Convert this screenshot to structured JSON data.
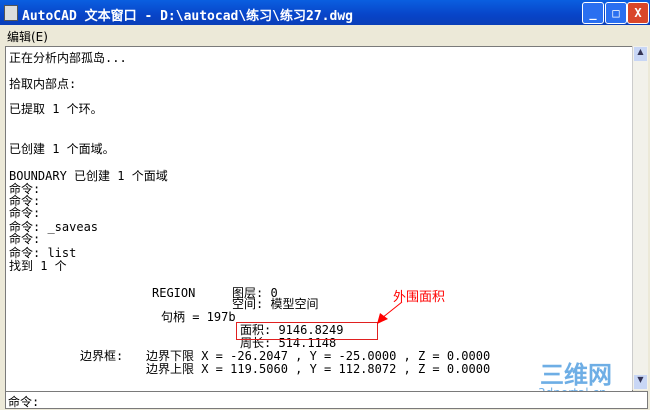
{
  "window": {
    "title": "AutoCAD 文本窗口 - D:\\autocad\\练习\\练习27.dwg",
    "minimize": "_",
    "maximize": "□",
    "close": "X"
  },
  "menu": {
    "edit": "编辑(E)"
  },
  "lines": [
    "正在分析内部孤岛...",
    "拾取内部点:",
    "已提取 1 个环。",
    "已创建 1 个面域。",
    "BOUNDARY 已创建 1 个面域",
    "命令:",
    "命令:",
    "命令:",
    "命令: _saveas",
    "命令:",
    "命令: list",
    "找到 1 个"
  ],
  "region": {
    "type": "REGION",
    "layer": "图层: 0",
    "space": "空间: 模型空间",
    "handle": "句柄 = 197b",
    "area": "面积: 9146.8249",
    "perimeter": "周长: 514.1148",
    "bbox_label": "边界框:",
    "lower": "边界下限 X = -26.2047 , Y = -25.0000 , Z = 0.0000",
    "upper": "边界上限 X = 119.5060 , Y = 112.8072 , Z = 0.0000"
  },
  "annotation": "外围面积",
  "command_prompt": "命令:",
  "watermark": {
    "logo": "三维网",
    "site": "3dportal.cn"
  }
}
